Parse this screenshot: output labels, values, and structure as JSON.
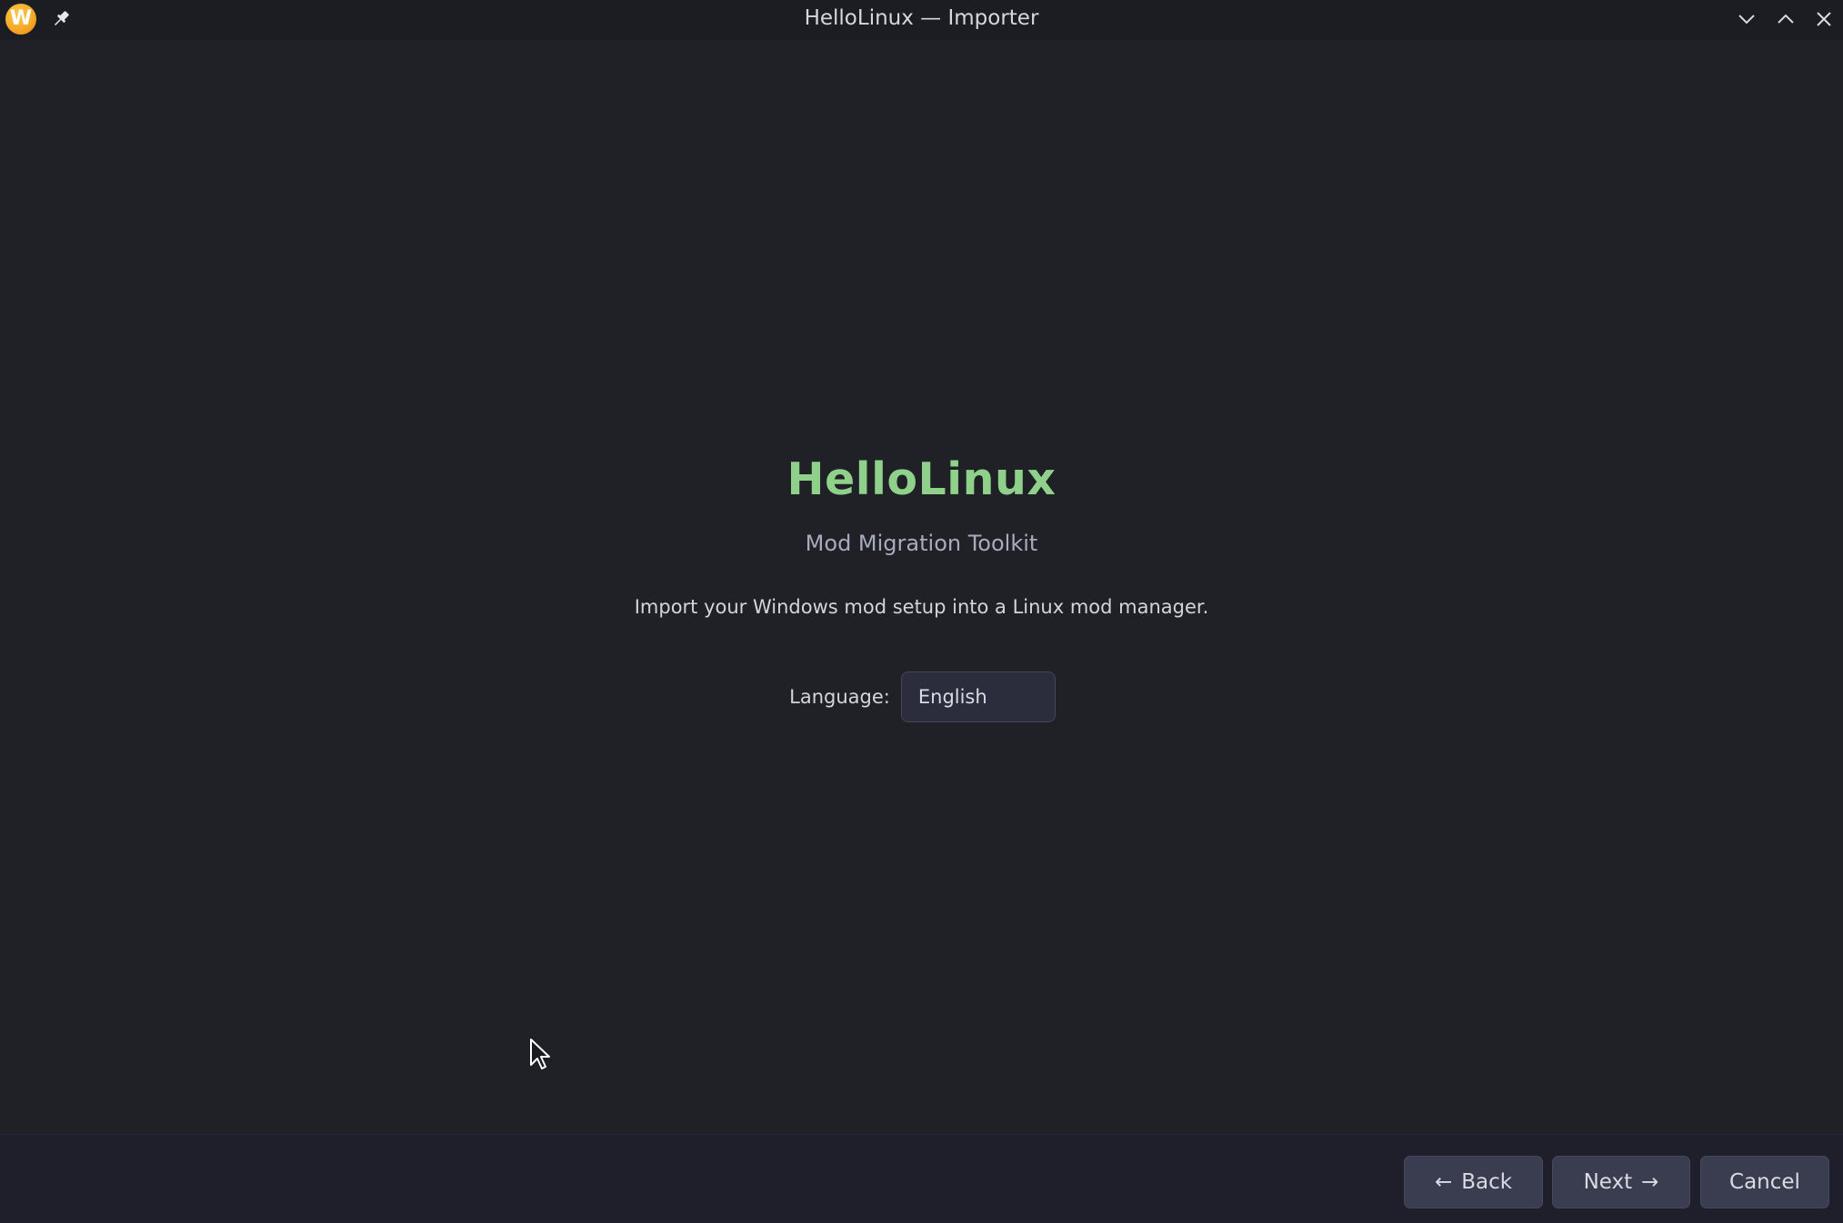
{
  "window": {
    "title": "HelloLinux — Importer",
    "app_icon_letter": "W",
    "icons": {
      "app": "app-logo-icon",
      "pin": "pin-icon",
      "minimize": "chevron-down-icon",
      "maximize": "chevron-up-icon",
      "close": "close-icon"
    }
  },
  "welcome": {
    "title": "HelloLinux",
    "subtitle": "Mod Migration Toolkit",
    "description": "Import your Windows mod setup into a Linux mod manager.",
    "language_label": "Language:",
    "language_value": "English"
  },
  "footer": {
    "back_label": "Back",
    "back_arrow": "←",
    "next_label": "Next",
    "next_arrow": "→",
    "cancel_label": "Cancel"
  },
  "colors": {
    "background": "#202127",
    "titlebar": "#1c1d22",
    "accent_title": "#8fd18a",
    "footer": "#1e1f2b",
    "button": "#3a3c4f",
    "app_icon": "#f5a623"
  }
}
